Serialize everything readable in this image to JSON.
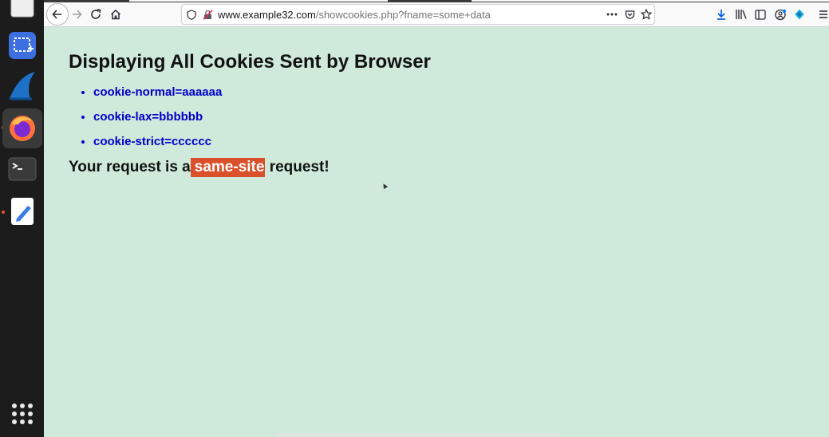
{
  "dock": {
    "items": [
      {
        "name": "files"
      },
      {
        "name": "screenshot-tool"
      },
      {
        "name": "wireshark"
      },
      {
        "name": "firefox"
      },
      {
        "name": "terminal"
      },
      {
        "name": "text-editor"
      }
    ],
    "accent": "#e95420"
  },
  "browser": {
    "url_host": "www.example32.com",
    "url_path": "/showcookies.php?fname=some+data"
  },
  "page": {
    "title": "Displaying All Cookies Sent by Browser",
    "cookies": [
      "cookie-normal=aaaaaa",
      "cookie-lax=bbbbbb",
      "cookie-strict=cccccc"
    ],
    "request_prefix": "Your request is a",
    "request_type": "same-site",
    "request_suffix": "request!",
    "background": "#cfe9da",
    "link_color": "#0000cc",
    "badge_color": "#d9502a"
  }
}
